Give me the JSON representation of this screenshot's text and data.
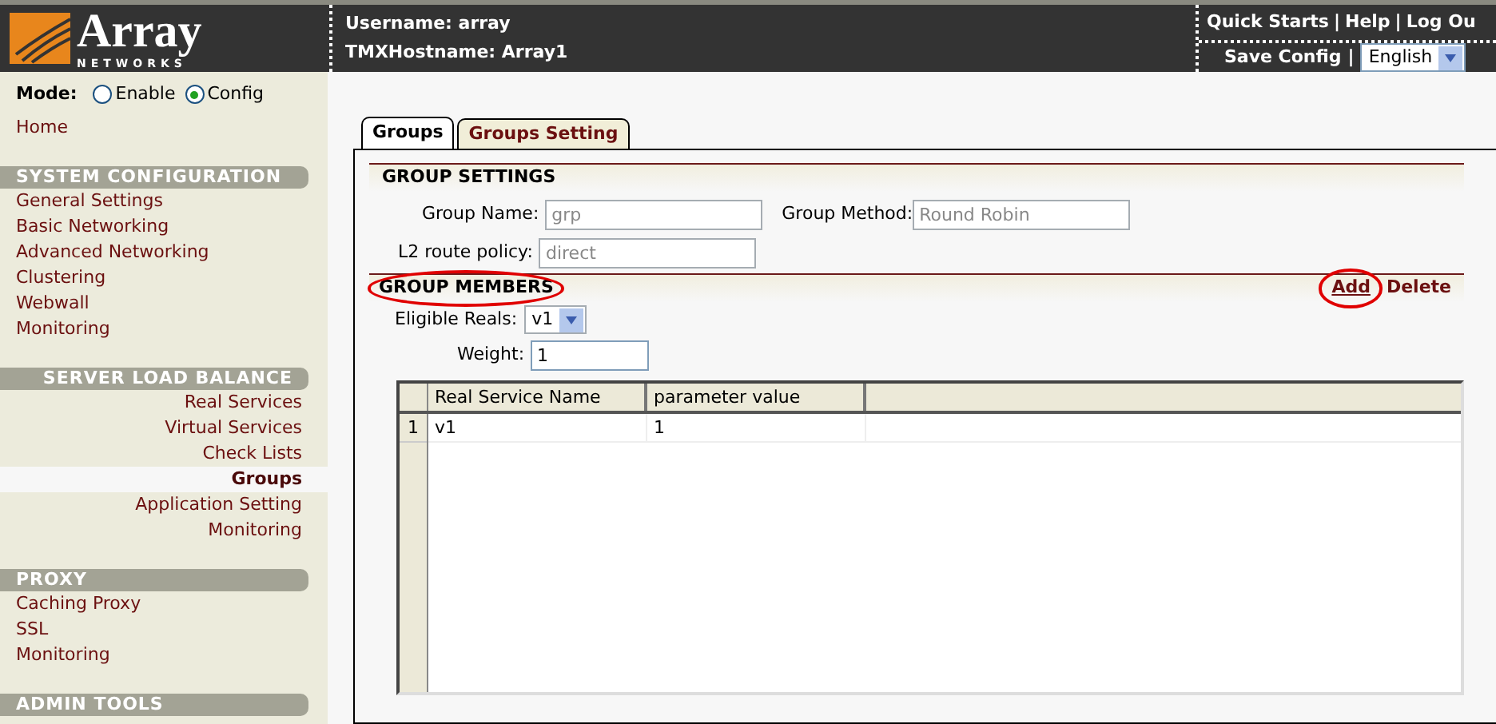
{
  "header": {
    "logo": {
      "name": "Array",
      "sub": "NETWORKS"
    },
    "username": "Username: array",
    "hostname": "TMXHostname: Array1",
    "links": [
      {
        "label": "Quick Starts"
      },
      {
        "separator": "|",
        "label": "Help"
      },
      {
        "separator": "|",
        "label": "Log Ou"
      }
    ],
    "save_config": "Save Config",
    "save_separator": "|",
    "language": {
      "value": "English"
    }
  },
  "sidebar": {
    "mode": {
      "label": "Mode:",
      "options": [
        {
          "label": "Enable",
          "selected": false
        },
        {
          "label": "Config",
          "selected": true
        }
      ]
    },
    "home": "Home",
    "sections": [
      {
        "title": "SYSTEM CONFIGURATION",
        "kind": "flush",
        "items": [
          {
            "label": "General Settings",
            "selected": false
          },
          {
            "label": "Basic Networking",
            "selected": false
          },
          {
            "label": "Advanced Networking",
            "selected": false
          },
          {
            "label": "Clustering",
            "selected": false
          },
          {
            "label": "Webwall",
            "selected": false
          },
          {
            "label": "Monitoring",
            "selected": false
          }
        ]
      },
      {
        "title": "SERVER LOAD BALANCE",
        "kind": "right",
        "items": [
          {
            "label": "Real Services",
            "selected": false
          },
          {
            "label": "Virtual Services",
            "selected": false
          },
          {
            "label": "Check Lists",
            "selected": false
          },
          {
            "label": "Groups",
            "selected": true
          },
          {
            "label": "Application Setting",
            "selected": false
          },
          {
            "label": "Monitoring",
            "selected": false
          }
        ]
      },
      {
        "title": "PROXY",
        "kind": "flush",
        "items": [
          {
            "label": "Caching Proxy",
            "selected": false
          },
          {
            "label": "SSL",
            "selected": false
          },
          {
            "label": "Monitoring",
            "selected": false
          }
        ]
      },
      {
        "title": "ADMIN TOOLS",
        "kind": "flush"
      }
    ]
  },
  "tabs": [
    {
      "label": "Groups",
      "selected": true
    },
    {
      "label": "Groups Setting",
      "selected": false
    }
  ],
  "group_settings": {
    "title": "GROUP SETTINGS",
    "group_name": {
      "label": "Group Name:",
      "value": "grp",
      "disabled": true
    },
    "group_method": {
      "label": "Group Method:",
      "value": "Round Robin",
      "disabled": true
    },
    "l2_route_policy": {
      "label": "L2 route policy:",
      "value": "direct",
      "disabled": true
    }
  },
  "group_members": {
    "title": "GROUP MEMBERS",
    "circled": true,
    "actions": [
      {
        "label": "Add",
        "circled": true
      },
      {
        "label": "Delete",
        "circled": false
      }
    ],
    "eligible_reals": {
      "label": "Eligible Reals:",
      "value": "v1"
    },
    "weight": {
      "label": "Weight:",
      "value": "1"
    }
  },
  "table": {
    "columns": [
      "Real Service Name",
      "parameter value"
    ],
    "rows": [
      {
        "number": "1",
        "cells": [
          "v1",
          "1"
        ]
      }
    ]
  }
}
